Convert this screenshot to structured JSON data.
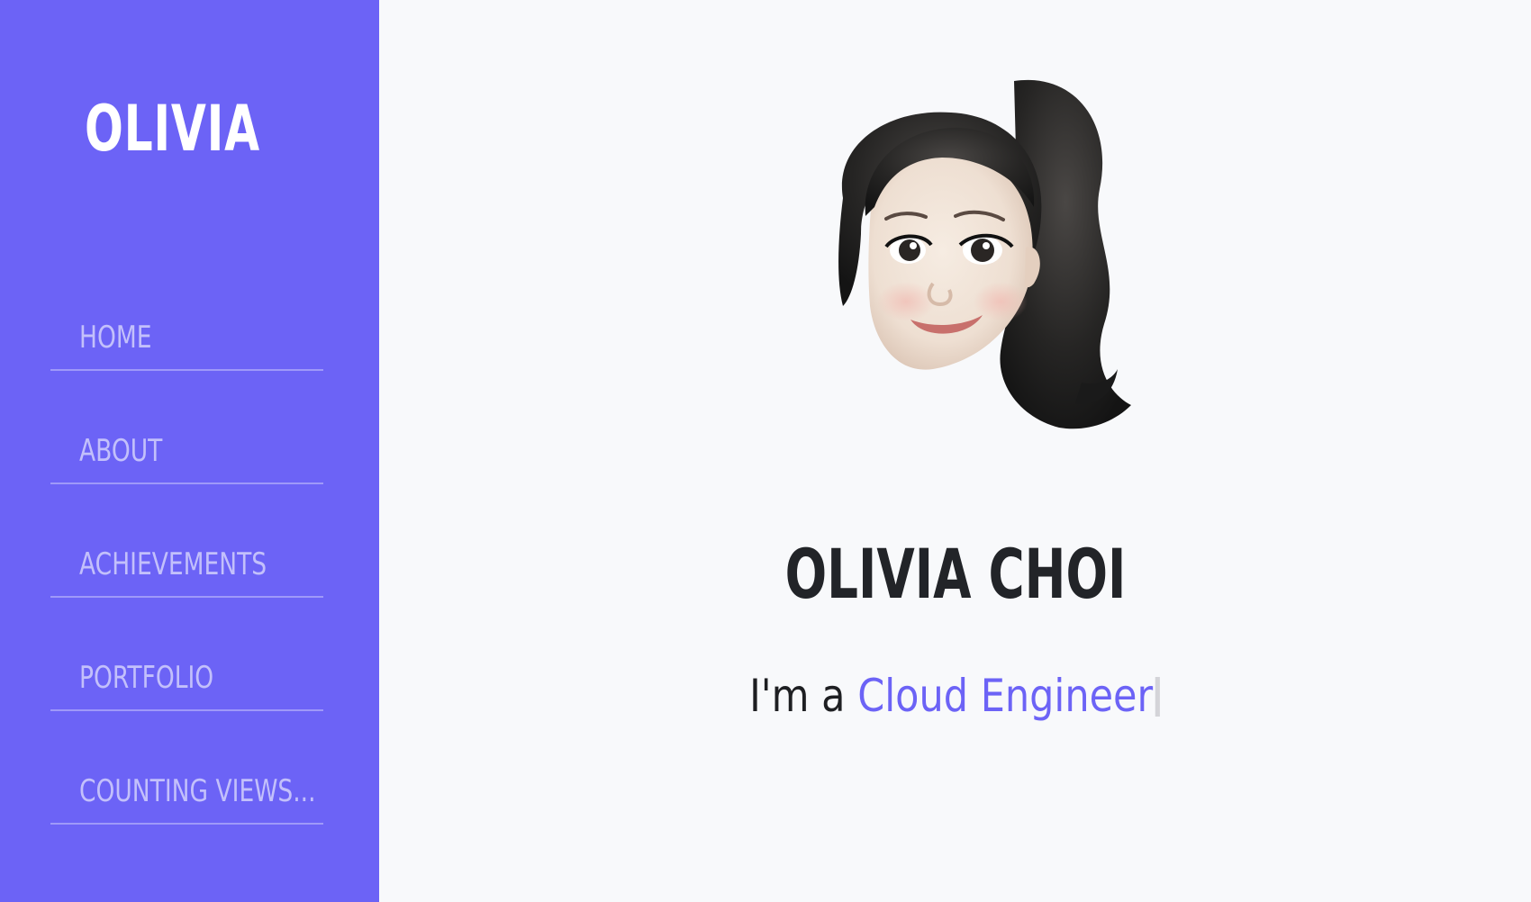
{
  "sidebar": {
    "brand": "OLIVIA",
    "items": [
      {
        "label": "HOME"
      },
      {
        "label": "ABOUT"
      },
      {
        "label": "ACHIEVEMENTS"
      },
      {
        "label": "PORTFOLIO"
      },
      {
        "label": "COUNTING VIEWS..."
      }
    ]
  },
  "hero": {
    "avatar_icon": "memoji-avatar-icon",
    "name": "OLIVIA CHOI",
    "tagline_prefix": "I'm a",
    "tagline_role": "Cloud Engineer"
  },
  "colors": {
    "sidebar_bg": "#6c63f6",
    "accent": "#6c63f6",
    "page_bg": "#f8f9fb",
    "text_dark": "#222428"
  }
}
